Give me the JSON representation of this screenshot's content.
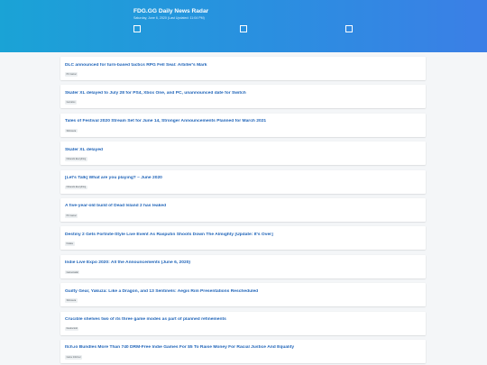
{
  "header": {
    "title": "FDG.GG Daily News Radar",
    "subtitle": "Saturday, June 6, 2020 (Last Updated: 11:04 PM)"
  },
  "news": [
    {
      "title": "DLC announced for turn-based tactics RPG Fell Seal: Arbiter's Mark",
      "source": "PC Gamer"
    },
    {
      "title": "Skater XL delayed to July 28 for PS4, Xbox One, and PC, unannounced date for Switch",
      "source": "Gematsu"
    },
    {
      "title": "Tales of Festival 2020 Stream Set for June 14, Stronger Announcements Planned for March 2021",
      "source": "Siliconera"
    },
    {
      "title": "Skater XL delayed",
      "source": "Nintendo Everything"
    },
    {
      "title": "[Let's Talk] What are you playing? – June 2020",
      "source": "Nintendo Everything"
    },
    {
      "title": "A five-year-old build of Dead Island 2 has leaked",
      "source": "PC Gamer"
    },
    {
      "title": "Destiny 2 Gets Fortnite-Style Live Event As Rasputin Shoots Down The Almighty [Update: It's Over]",
      "source": "Kotaku"
    },
    {
      "title": "Indie Live Expo 2020: All the Announcements (June 6, 2020)",
      "source": "Gamesradar"
    },
    {
      "title": "Guilty Gear, Yakuza: Like a Dragon, and 13 Sentinels: Aegis Rim Presentations Rescheduled",
      "source": "Siliconera"
    },
    {
      "title": "Crucible shelves two of its three game modes as part of planned refinements",
      "source": "Destructoid"
    },
    {
      "title": "Itch.io Bundles More Than 740 DRM-Free Indie Games For $5 To Raise Money For Racial Justice And Equality",
      "source": "Game Informer"
    }
  ]
}
